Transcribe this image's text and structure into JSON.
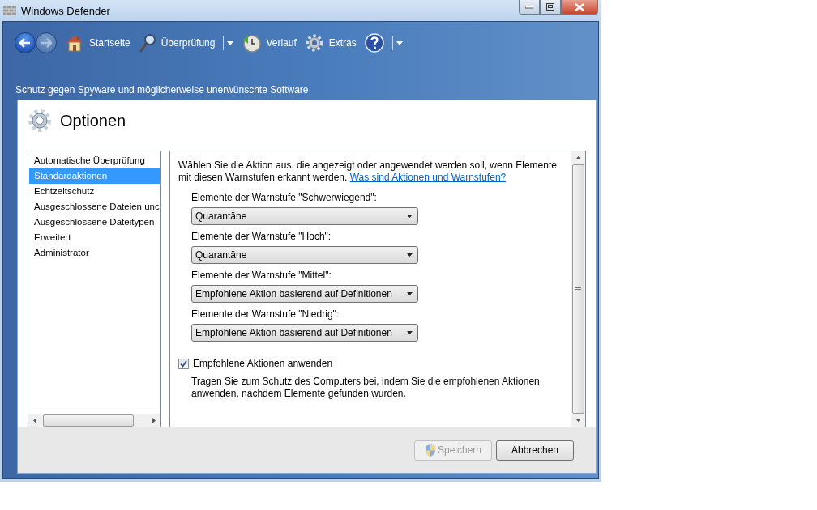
{
  "window": {
    "title": "Windows Defender"
  },
  "toolbar": [
    {
      "kind": "nav"
    },
    {
      "kind": "home",
      "label": "Startseite"
    },
    {
      "kind": "scan",
      "label": "Überprüfung"
    },
    {
      "kind": "dropdown"
    },
    {
      "kind": "history",
      "label": "Verlauf"
    },
    {
      "kind": "tools",
      "label": "Extras"
    },
    {
      "kind": "help"
    },
    {
      "kind": "dropdown"
    }
  ],
  "subtitle": "Schutz gegen Spyware und möglicherweise unerwünschte Software",
  "page": {
    "title": "Optionen"
  },
  "sidebar": {
    "items": [
      {
        "label": "Automatische Überprüfung",
        "selected": false
      },
      {
        "label": "Standardaktionen",
        "selected": true
      },
      {
        "label": "Echtzeitschutz",
        "selected": false
      },
      {
        "label": "Ausgeschlossene Dateien unc",
        "selected": false
      },
      {
        "label": "Ausgeschlossene Dateitypen",
        "selected": false
      },
      {
        "label": "Erweitert",
        "selected": false
      },
      {
        "label": "Administrator",
        "selected": false
      }
    ]
  },
  "content": {
    "intro": "Wählen Sie die Aktion aus, die angezeigt oder angewendet werden soll, wenn Elemente mit diesen Warnstufen erkannt werden.",
    "link": "Was sind Aktionen und Warnstufen?",
    "levels": [
      {
        "label": "Elemente der Warnstufe \"Schwerwiegend\":",
        "value": "Quarantäne"
      },
      {
        "label": "Elemente der Warnstufe \"Hoch\":",
        "value": "Quarantäne"
      },
      {
        "label": "Elemente der Warnstufe \"Mittel\":",
        "value": "Empfohlene Aktion basierend auf Definitionen"
      },
      {
        "label": "Elemente der Warnstufe \"Niedrig\":",
        "value": "Empfohlene Aktion basierend auf Definitionen"
      }
    ],
    "checkbox": {
      "label": "Empfohlene Aktionen anwenden",
      "checked": true
    },
    "description": "Tragen Sie zum Schutz des Computers bei, indem Sie die empfohlenen Aktionen anwenden, nachdem Elemente gefunden wurden."
  },
  "buttons": [
    {
      "kind": "admin",
      "label": "Speichern",
      "disabled": true
    },
    {
      "kind": "plain",
      "label": "Abbrechen",
      "disabled": false
    }
  ]
}
